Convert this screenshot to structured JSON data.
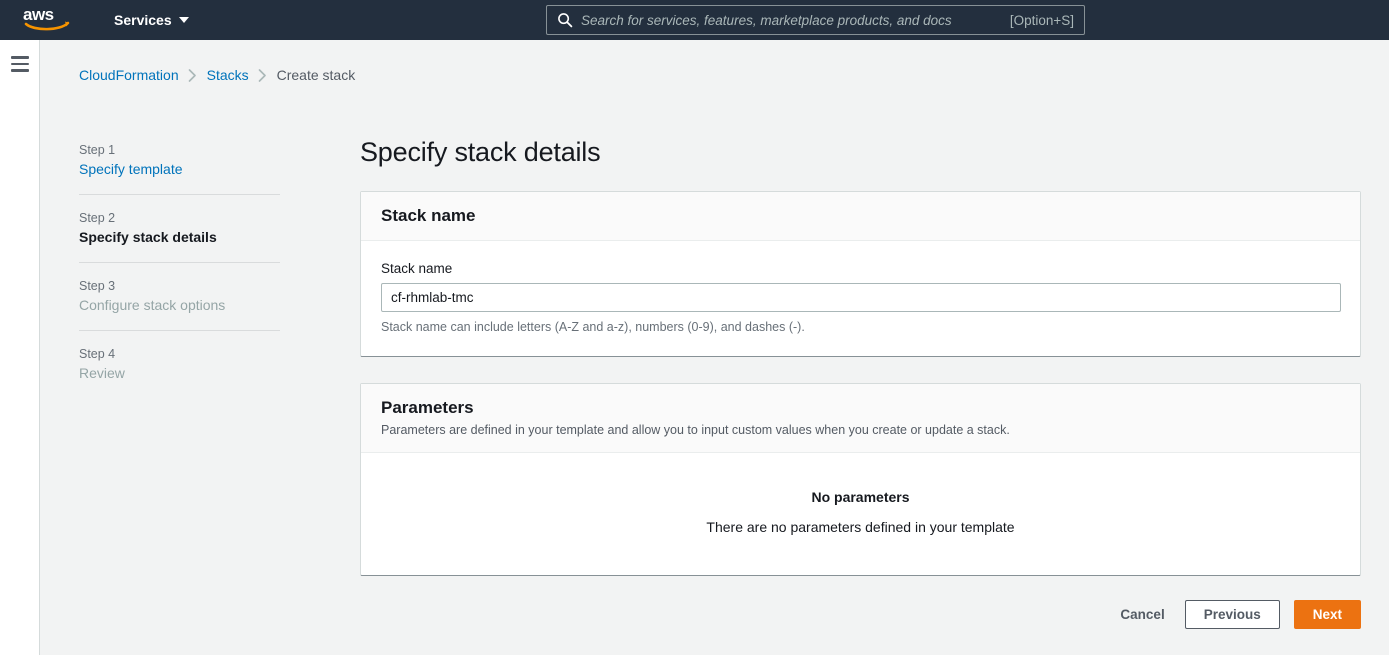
{
  "topnav": {
    "logo_text": "aws",
    "services_label": "Services",
    "search": {
      "placeholder": "Search for services, features, marketplace products, and docs",
      "shortcut": "[Option+S]",
      "value": ""
    }
  },
  "breadcrumb": [
    {
      "label": "CloudFormation",
      "type": "link"
    },
    {
      "label": "Stacks",
      "type": "link"
    },
    {
      "label": "Create stack",
      "type": "current"
    }
  ],
  "wizard": {
    "steps": [
      {
        "number": "Step 1",
        "title": "Specify template",
        "state": "link"
      },
      {
        "number": "Step 2",
        "title": "Specify stack details",
        "state": "active"
      },
      {
        "number": "Step 3",
        "title": "Configure stack options",
        "state": "disabled"
      },
      {
        "number": "Step 4",
        "title": "Review",
        "state": "disabled"
      }
    ]
  },
  "main": {
    "page_title": "Specify stack details",
    "stack_name_card": {
      "title": "Stack name",
      "field_label": "Stack name",
      "value": "cf-rhmlab-tmc",
      "placeholder": "",
      "hint": "Stack name can include letters (A-Z and a-z), numbers (0-9), and dashes (-)."
    },
    "parameters_card": {
      "title": "Parameters",
      "subtitle": "Parameters are defined in your template and allow you to input custom values when you create or update a stack.",
      "empty_title": "No parameters",
      "empty_text": "There are no parameters defined in your template"
    },
    "actions": {
      "cancel": "Cancel",
      "previous": "Previous",
      "next": "Next"
    }
  },
  "colors": {
    "nav_background": "#232f3e",
    "page_background": "#f2f3f3",
    "link": "#0073bb",
    "primary_button": "#ec7211",
    "logo_smile": "#f79400"
  }
}
